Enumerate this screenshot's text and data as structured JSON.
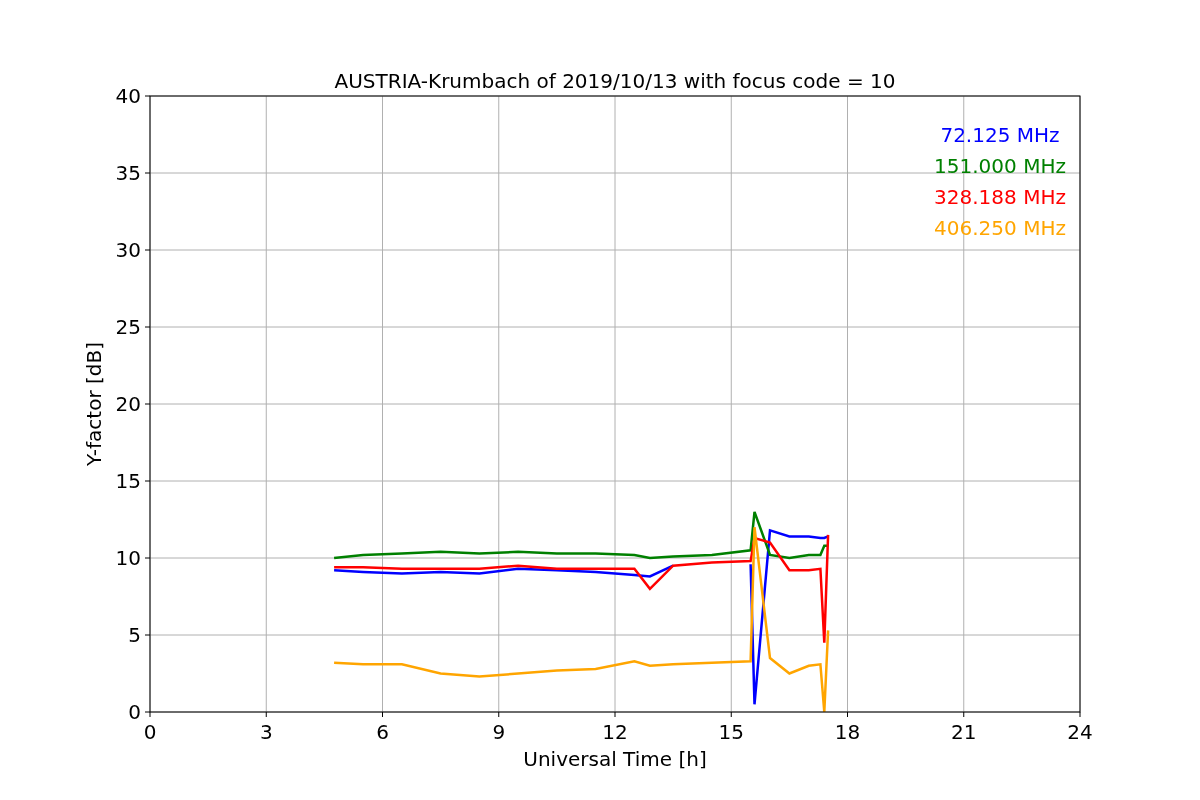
{
  "figure": {
    "chart_data": {
      "type": "line",
      "title": "AUSTRIA-Krumbach of 2019/10/13 with focus code = 10",
      "xlabel": "Universal Time [h]",
      "ylabel": "Y-factor [dB]",
      "x": [
        4.75,
        5.5,
        6.5,
        7.5,
        8.5,
        9.5,
        10.5,
        11.5,
        12.5,
        12.9,
        13.5,
        14.5,
        15.5,
        15.6,
        16.0,
        16.5,
        17.0,
        17.3,
        17.4,
        17.5
      ],
      "series": [
        {
          "name": "72.125 MHz",
          "color": "#0000ff",
          "values": [
            9.2,
            9.1,
            9.0,
            9.1,
            9.0,
            9.3,
            9.2,
            9.1,
            8.9,
            8.8,
            9.5,
            null,
            9.6,
            0.5,
            11.8,
            11.4,
            11.4,
            11.3,
            11.3,
            11.4
          ]
        },
        {
          "name": "151.000 MHz",
          "color": "#008000",
          "values": [
            10.0,
            10.2,
            10.3,
            10.4,
            10.3,
            10.4,
            10.3,
            10.3,
            10.2,
            10.0,
            10.1,
            10.2,
            10.5,
            13.0,
            10.2,
            10.0,
            10.2,
            10.2,
            10.8,
            10.8
          ]
        },
        {
          "name": "328.188 MHz",
          "color": "#ff0000",
          "values": [
            9.4,
            9.4,
            9.3,
            9.3,
            9.3,
            9.5,
            9.3,
            9.3,
            9.3,
            8.0,
            9.5,
            9.7,
            9.8,
            11.3,
            11.0,
            9.2,
            9.2,
            9.3,
            4.5,
            11.5
          ]
        },
        {
          "name": "406.250 MHz",
          "color": "#ffa500",
          "values": [
            3.2,
            3.1,
            3.1,
            2.5,
            2.3,
            2.5,
            2.7,
            2.8,
            3.3,
            3.0,
            3.1,
            3.2,
            3.3,
            12.0,
            3.5,
            2.5,
            3.0,
            3.1,
            0,
            5.3
          ]
        }
      ],
      "grid": true,
      "xlim": [
        0,
        24
      ],
      "ylim": [
        0,
        40
      ],
      "xticks": [
        0,
        3,
        6,
        9,
        12,
        15,
        18,
        21,
        24
      ],
      "yticks": [
        0,
        5,
        10,
        15,
        20,
        25,
        30,
        35,
        40
      ]
    }
  }
}
